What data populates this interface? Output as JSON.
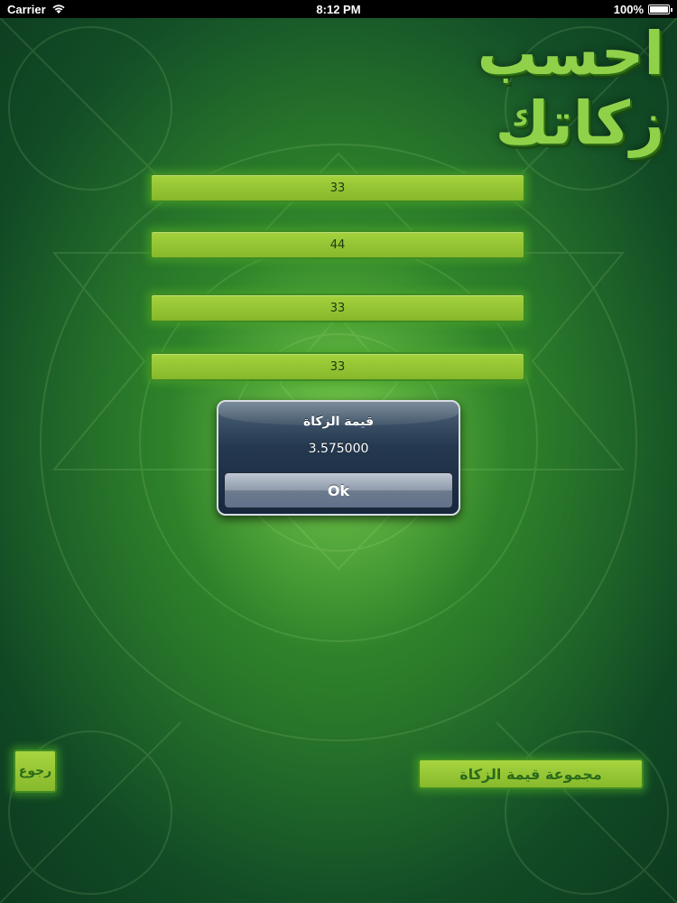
{
  "status_bar": {
    "carrier": "Carrier",
    "time": "8:12 PM",
    "battery": "100%"
  },
  "app": {
    "logo_text": "احسب زكاتك"
  },
  "fields": [
    {
      "value": "33"
    },
    {
      "value": "44"
    },
    {
      "value": "33"
    },
    {
      "value": "33"
    }
  ],
  "alert": {
    "title": "قيمة الزكاة",
    "message": "3.575000",
    "button_label": "Ok"
  },
  "buttons": {
    "back_label": "رجوع",
    "total_label": "مجموعة قيمة الزكاة"
  },
  "colors": {
    "accent": "#8fd24a",
    "field": "#a4d23d",
    "background": "#16572a"
  }
}
